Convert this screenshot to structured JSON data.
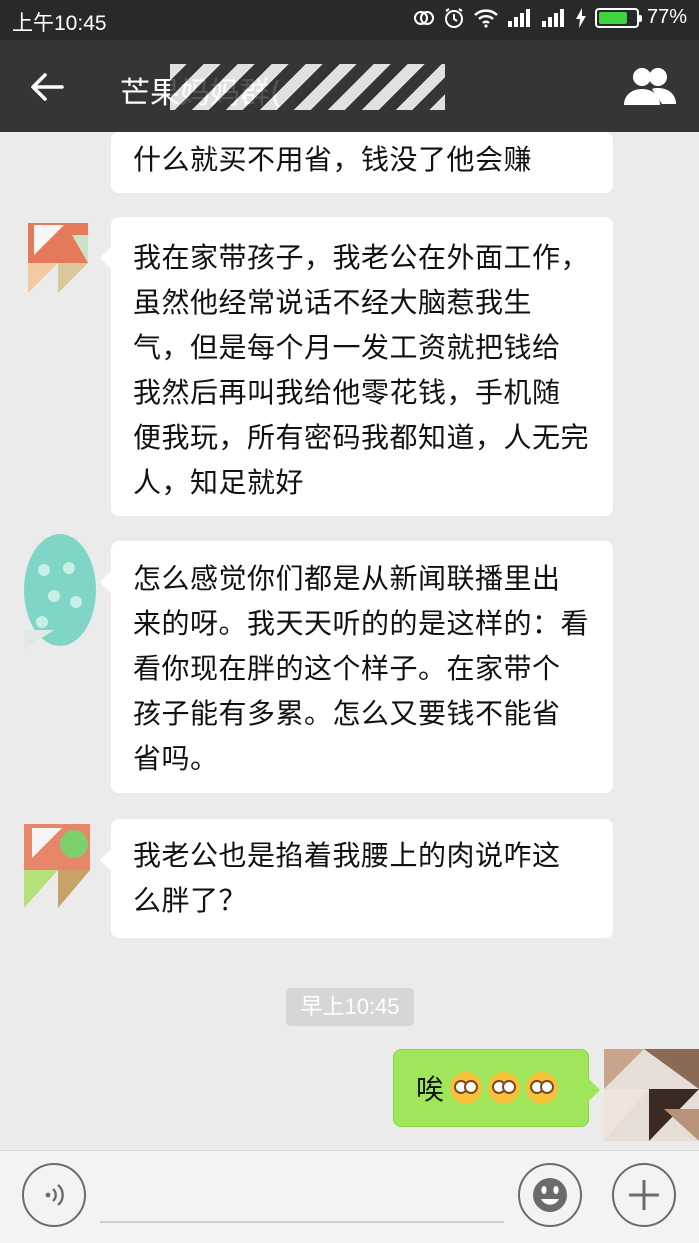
{
  "status_bar": {
    "time": "上午10:45",
    "battery_text": "77%",
    "battery_level": 0.77
  },
  "header": {
    "title": "芒果妈妈群(",
    "back_icon": "arrow-left-icon",
    "members_icon": "group-members-icon"
  },
  "messages": [
    {
      "side": "left",
      "text": "什么就买不用省，钱没了他会赚"
    },
    {
      "side": "left",
      "text": "我在家带孩子，我老公在外面工作，\n虽然他经常说话不经大脑惹我生\n气，但是每个月一发工资就把钱给\n我然后再叫我给他零花钱，手机随\n便我玩，所有密码我都知道，人无完\n人，知足就好"
    },
    {
      "side": "left",
      "text": "怎么感觉你们都是从新闻联播里出\n来的呀。我天天听的的是这样的：看\n看你现在胖的这个样子。在家带个\n孩子能有多累。怎么又要钱不能省\n省吗。"
    },
    {
      "side": "left",
      "text": "我老公也是掐着我腰上的肉说咋这\n么胖了？"
    }
  ],
  "timestamp": "早上10:45",
  "my_message": {
    "text": "唉",
    "emoji": [
      "flushed-face-emoji",
      "flushed-face-emoji",
      "flushed-face-emoji"
    ]
  },
  "input_bar": {
    "voice_icon": "voice-input-icon",
    "emoji_icon": "smiley-icon",
    "plus_icon": "plus-icon"
  },
  "colors": {
    "header_bg": "#333537",
    "chat_bg": "#ebebeb",
    "my_bubble": "#9fe65a",
    "battery_green": "#3fd43f"
  }
}
